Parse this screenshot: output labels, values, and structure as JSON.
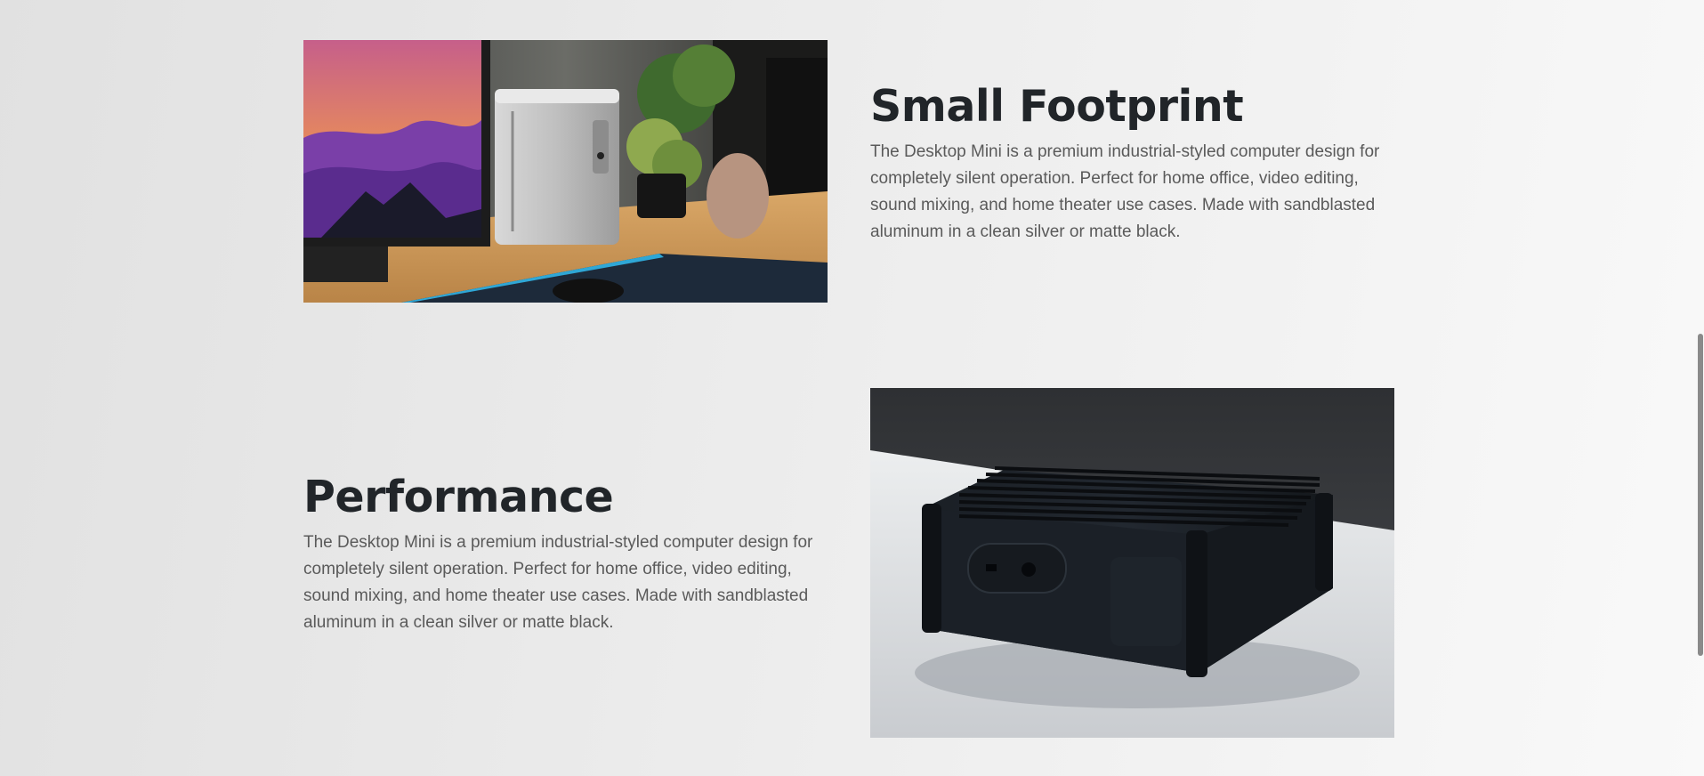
{
  "features": [
    {
      "title": "Small Footprint",
      "description": "The Desktop Mini is a premium industrial-styled computer design for completely silent operation. Perfect for home office, video editing, sound mixing, and home theater use cases. Made with sandblasted aluminum in a clean silver or matte black."
    },
    {
      "title": "Performance",
      "description": "The Desktop Mini is a premium industrial-styled computer design for completely silent operation. Perfect for home office, video editing, sound mixing, and home theater use cases. Made with sandblasted aluminum in a clean silver or matte black."
    }
  ]
}
